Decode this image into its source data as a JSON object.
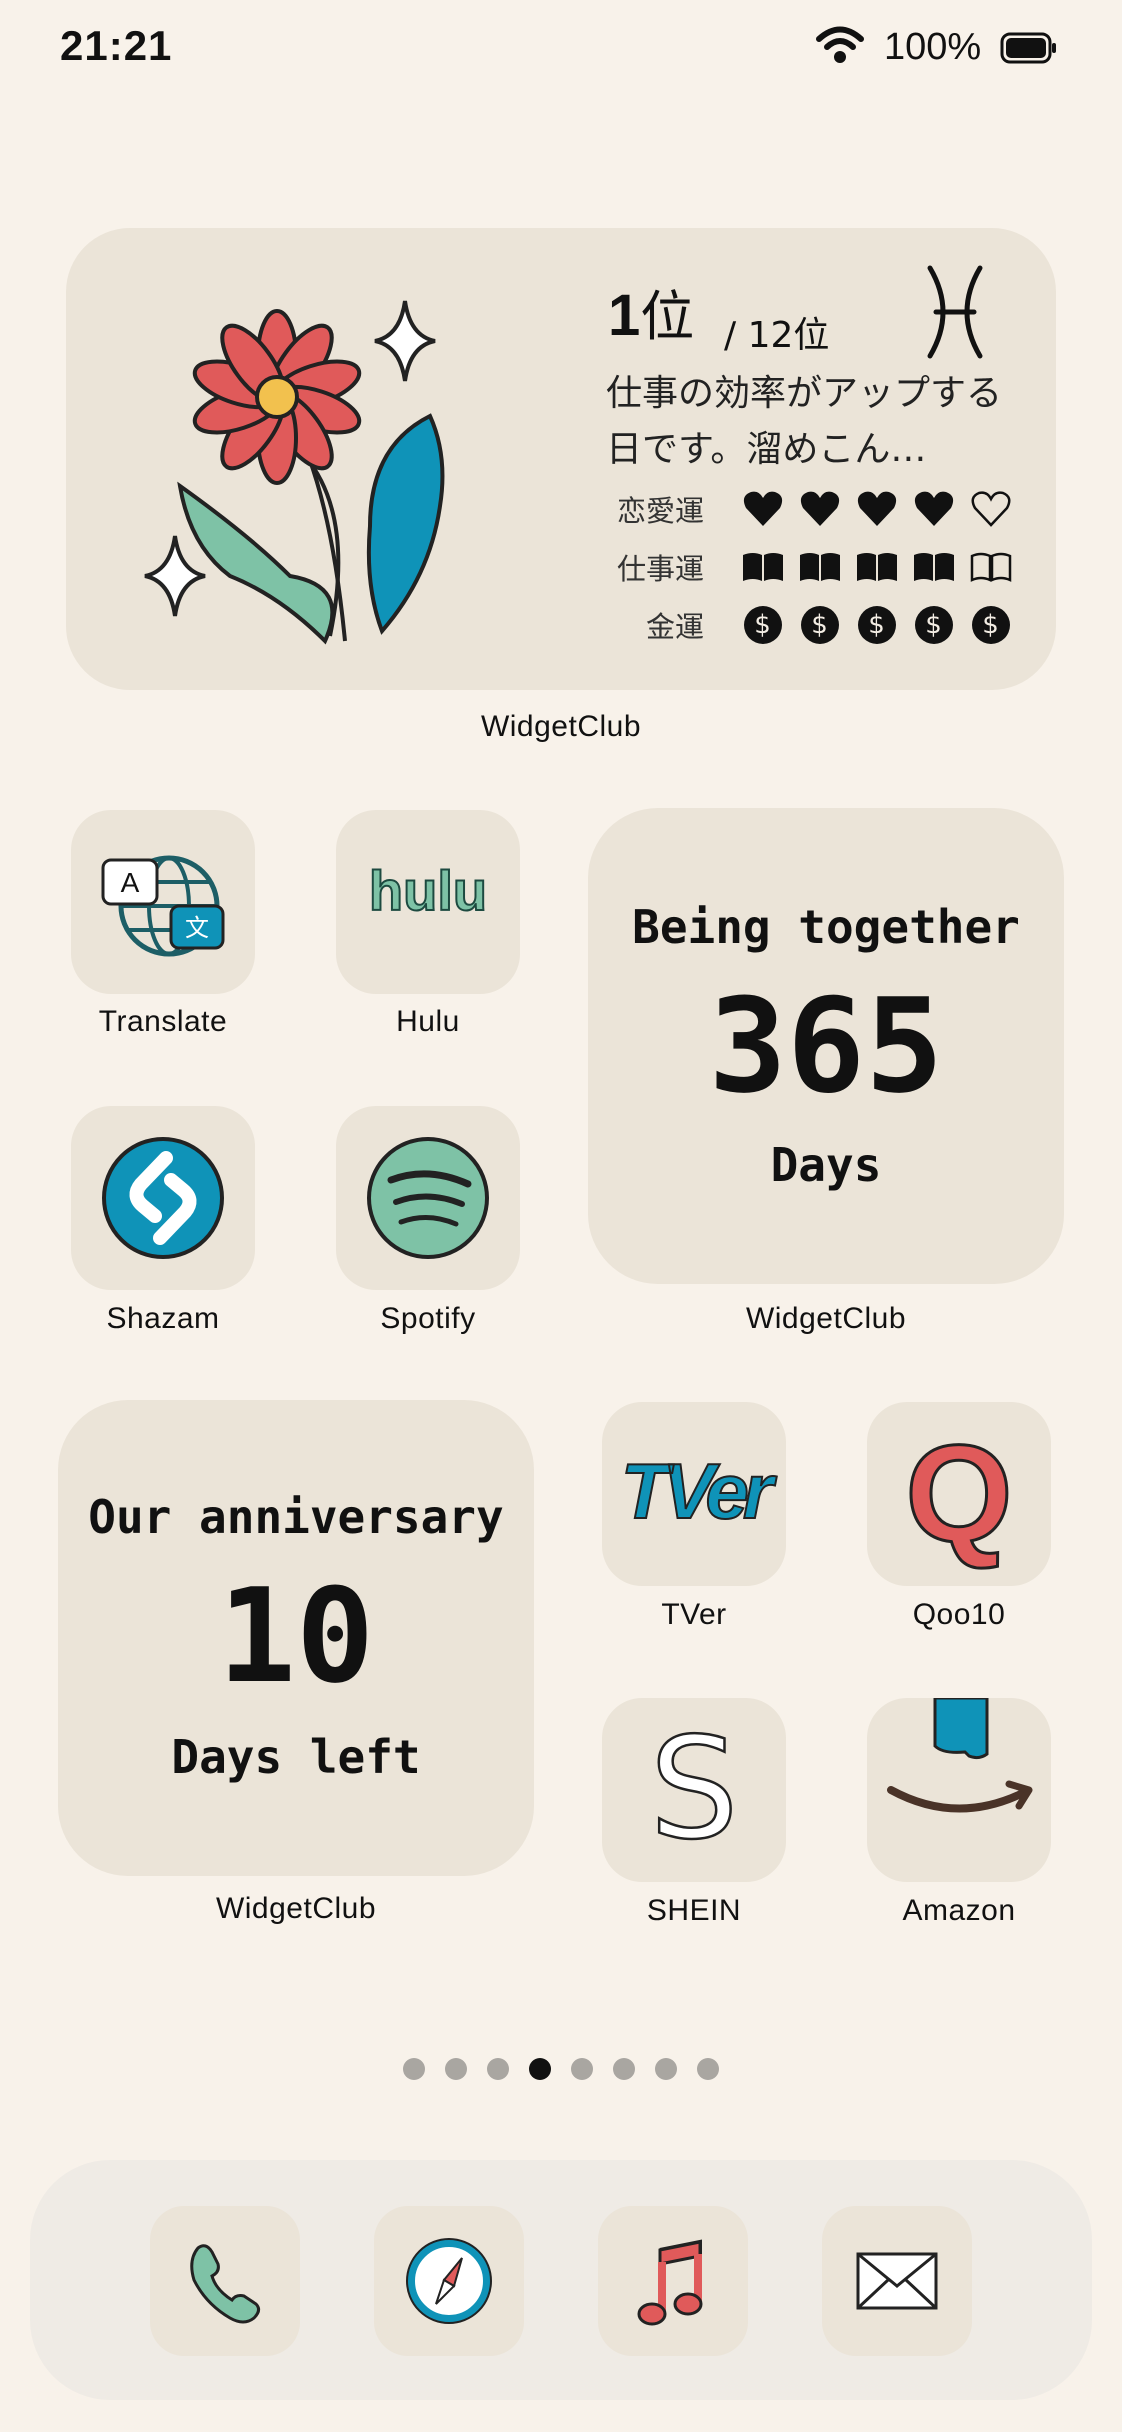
{
  "status_bar": {
    "time": "21:21",
    "battery": "100%"
  },
  "horoscope_widget": {
    "rank": "1",
    "rank_suffix": "位",
    "total": "/ 12位",
    "sign_symbol": "♓",
    "message": "仕事の効率がアップする日です。溜めこん…",
    "rows": [
      {
        "label": "恋愛運",
        "score": 4,
        "max": 5,
        "icon": "heart"
      },
      {
        "label": "仕事運",
        "score": 4,
        "max": 5,
        "icon": "book"
      },
      {
        "label": "金運",
        "score": 5,
        "max": 5,
        "icon": "coin"
      }
    ],
    "caption": "WidgetClub"
  },
  "apps": [
    {
      "name": "Translate",
      "icon": "translate-icon"
    },
    {
      "name": "Hulu",
      "icon": "hulu-icon",
      "logo_text": "hulu"
    },
    {
      "name": "Shazam",
      "icon": "shazam-icon"
    },
    {
      "name": "Spotify",
      "icon": "spotify-icon"
    },
    {
      "name": "TVer",
      "icon": "tver-icon",
      "logo_text": "TVer"
    },
    {
      "name": "Qoo10",
      "icon": "qoo10-icon",
      "logo_text": "Q"
    },
    {
      "name": "SHEIN",
      "icon": "shein-icon",
      "logo_text": "S"
    },
    {
      "name": "Amazon",
      "icon": "amazon-icon"
    }
  ],
  "together_widget": {
    "title": "Being together",
    "count": "365",
    "unit": "Days",
    "caption": "WidgetClub"
  },
  "anniversary_widget": {
    "title": "Our anniversary",
    "count": "10",
    "unit": "Days left",
    "caption": "WidgetClub"
  },
  "page_indicator": {
    "pages": 8,
    "current": 4
  },
  "dock": [
    {
      "name": "Phone",
      "icon": "phone-icon"
    },
    {
      "name": "Safari",
      "icon": "compass-icon"
    },
    {
      "name": "Music",
      "icon": "music-note-icon"
    },
    {
      "name": "Mail",
      "icon": "mail-icon"
    }
  ],
  "colors": {
    "background": "#f8f2ea",
    "tile": "#ebe4d8",
    "teal": "#0f93b8",
    "mint": "#7ec2a6",
    "red": "#e05a5a"
  }
}
